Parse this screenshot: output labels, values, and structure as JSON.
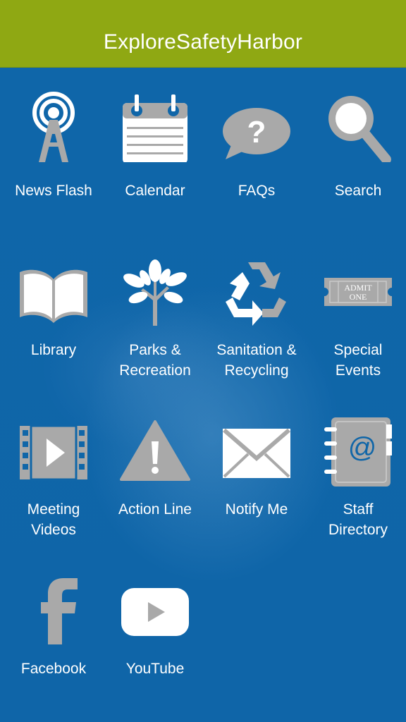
{
  "header": {
    "title": "ExploreSafetyHarbor"
  },
  "tiles": [
    {
      "label": "News Flash",
      "icon": "radio-tower-icon"
    },
    {
      "label": "Calendar",
      "icon": "calendar-icon"
    },
    {
      "label": "FAQs",
      "icon": "question-bubble-icon"
    },
    {
      "label": "Search",
      "icon": "magnifier-icon"
    },
    {
      "label": "Library",
      "icon": "open-book-icon"
    },
    {
      "label": "Parks &\nRecreation",
      "icon": "tree-icon"
    },
    {
      "label": "Sanitation &\nRecycling",
      "icon": "recycle-icon"
    },
    {
      "label": "Special\nEvents",
      "icon": "ticket-icon",
      "icon_text": "ADMIT ONE"
    },
    {
      "label": "Meeting\nVideos",
      "icon": "film-play-icon"
    },
    {
      "label": "Action Line",
      "icon": "warning-icon"
    },
    {
      "label": "Notify Me",
      "icon": "envelope-icon"
    },
    {
      "label": "Staff\nDirectory",
      "icon": "address-book-icon"
    },
    {
      "label": "Facebook",
      "icon": "facebook-icon"
    },
    {
      "label": "YouTube",
      "icon": "youtube-icon"
    }
  ],
  "colors": {
    "header": "#8fa813",
    "background": "#1066a8",
    "icon_gray": "#a9a9a9",
    "icon_white": "#ffffff"
  }
}
